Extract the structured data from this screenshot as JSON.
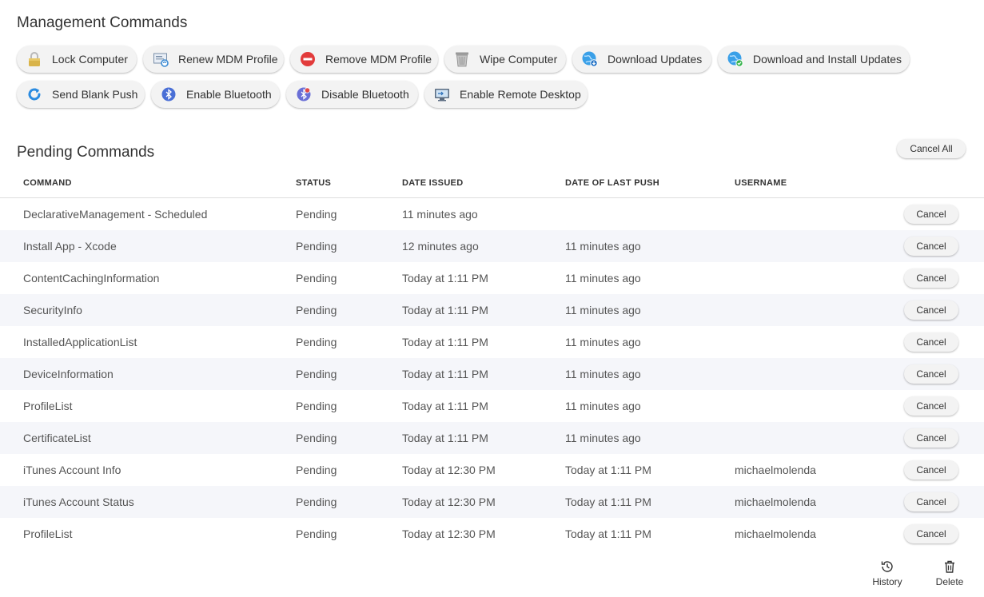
{
  "management": {
    "title": "Management Commands",
    "buttons": [
      {
        "label": "Lock Computer",
        "icon": "lock-icon"
      },
      {
        "label": "Renew MDM Profile",
        "icon": "mdm-profile-icon"
      },
      {
        "label": "Remove MDM Profile",
        "icon": "remove-icon"
      },
      {
        "label": "Wipe Computer",
        "icon": "trash-can-icon"
      },
      {
        "label": "Download Updates",
        "icon": "globe-download-icon"
      },
      {
        "label": "Download and Install Updates",
        "icon": "globe-install-icon"
      },
      {
        "label": "Send Blank Push",
        "icon": "refresh-icon"
      },
      {
        "label": "Enable Bluetooth",
        "icon": "bluetooth-icon"
      },
      {
        "label": "Disable Bluetooth",
        "icon": "bluetooth-disable-icon"
      },
      {
        "label": "Enable Remote Desktop",
        "icon": "remote-desktop-icon"
      }
    ]
  },
  "pending": {
    "title": "Pending Commands",
    "cancel_all_label": "Cancel All",
    "columns": [
      "COMMAND",
      "STATUS",
      "DATE ISSUED",
      "DATE OF LAST PUSH",
      "USERNAME"
    ],
    "cancel_label": "Cancel",
    "rows": [
      {
        "command": "DeclarativeManagement - Scheduled",
        "status": "Pending",
        "issued": "11 minutes ago",
        "push": "",
        "user": ""
      },
      {
        "command": "Install App - Xcode",
        "status": "Pending",
        "issued": "12 minutes ago",
        "push": "11 minutes ago",
        "user": ""
      },
      {
        "command": "ContentCachingInformation",
        "status": "Pending",
        "issued": "Today at 1:11 PM",
        "push": "11 minutes ago",
        "user": ""
      },
      {
        "command": "SecurityInfo",
        "status": "Pending",
        "issued": "Today at 1:11 PM",
        "push": "11 minutes ago",
        "user": ""
      },
      {
        "command": "InstalledApplicationList",
        "status": "Pending",
        "issued": "Today at 1:11 PM",
        "push": "11 minutes ago",
        "user": ""
      },
      {
        "command": "DeviceInformation",
        "status": "Pending",
        "issued": "Today at 1:11 PM",
        "push": "11 minutes ago",
        "user": ""
      },
      {
        "command": "ProfileList",
        "status": "Pending",
        "issued": "Today at 1:11 PM",
        "push": "11 minutes ago",
        "user": ""
      },
      {
        "command": "CertificateList",
        "status": "Pending",
        "issued": "Today at 1:11 PM",
        "push": "11 minutes ago",
        "user": ""
      },
      {
        "command": "iTunes Account Info",
        "status": "Pending",
        "issued": "Today at 12:30 PM",
        "push": "Today at 1:11 PM",
        "user": "michaelmolenda"
      },
      {
        "command": "iTunes Account Status",
        "status": "Pending",
        "issued": "Today at 12:30 PM",
        "push": "Today at 1:11 PM",
        "user": "michaelmolenda"
      },
      {
        "command": "ProfileList",
        "status": "Pending",
        "issued": "Today at 12:30 PM",
        "push": "Today at 1:11 PM",
        "user": "michaelmolenda"
      }
    ]
  },
  "footer": {
    "history_label": "History",
    "delete_label": "Delete"
  }
}
